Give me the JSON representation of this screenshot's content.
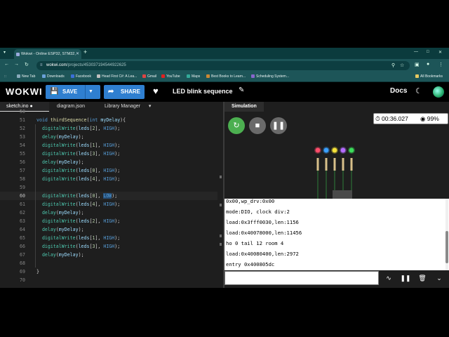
{
  "browser": {
    "tab_title": "Wokwi - Online ESP32, STM32,",
    "url_host": "wokwi.com",
    "url_path": "/projects/453037194544922625",
    "bookmarks": [
      {
        "label": "New Tab",
        "color": "#88aabb"
      },
      {
        "label": "Downloads",
        "color": "#6aa0d8"
      },
      {
        "label": "Facebook",
        "color": "#3b6fd8"
      },
      {
        "label": "Head First C#: A Lea...",
        "color": "#c0c0c0"
      },
      {
        "label": "Gmail",
        "color": "#d44"
      },
      {
        "label": "YouTube",
        "color": "#e02020"
      },
      {
        "label": "Maps",
        "color": "#3a9"
      },
      {
        "label": "Best Books to Learn...",
        "color": "#cc8833"
      },
      {
        "label": "Scheduling System...",
        "color": "#8866cc"
      }
    ],
    "all_bookmarks": "All Bookmarks"
  },
  "toolbar": {
    "logo": "WOKWI",
    "save_label": "SAVE",
    "share_label": "SHARE",
    "project_title": "LED blink sequence",
    "docs_label": "Docs"
  },
  "editor": {
    "tabs": [
      {
        "label": "sketch.ino",
        "modified": "●"
      },
      {
        "label": "diagram.json"
      },
      {
        "label": "Library Manager",
        "dropdown": "▾"
      }
    ],
    "lines": [
      {
        "num": "50",
        "text": ""
      },
      {
        "num": "51",
        "text": "void thirdSequence(int myDelay){"
      },
      {
        "num": "52",
        "text": "  digitalWrite(leds[2], HIGH);"
      },
      {
        "num": "53",
        "text": "  delay(myDelay);"
      },
      {
        "num": "54",
        "text": "  digitalWrite(leds[1], HIGH);"
      },
      {
        "num": "55",
        "text": "  digitalWrite(leds[3], HIGH);"
      },
      {
        "num": "56",
        "text": "  delay(myDelay);"
      },
      {
        "num": "57",
        "text": "  digitalWrite(leds[0], HIGH);"
      },
      {
        "num": "58",
        "text": "  digitalWrite(leds[4], HIGH);"
      },
      {
        "num": "59",
        "text": ""
      },
      {
        "num": "60",
        "text": "  digitalWrite(leds[0], LOW);"
      },
      {
        "num": "61",
        "text": "  digitalWrite(leds[4], HIGH);"
      },
      {
        "num": "62",
        "text": "  delay(myDelay);"
      },
      {
        "num": "63",
        "text": "  digitalWrite(leds[2], HIGH);"
      },
      {
        "num": "64",
        "text": "  delay(myDelay);"
      },
      {
        "num": "65",
        "text": "  digitalWrite(leds[1], HIGH);"
      },
      {
        "num": "66",
        "text": "  digitalWrite(leds[3], HIGH);"
      },
      {
        "num": "67",
        "text": "  delay(myDelay);"
      },
      {
        "num": "68",
        "text": ""
      },
      {
        "num": "69",
        "text": "}"
      },
      {
        "num": "70",
        "text": ""
      }
    ],
    "current_line": "60"
  },
  "simulation": {
    "tab_label": "Simulation",
    "elapsed": "00:36.027",
    "speed": "99%",
    "leds": [
      {
        "color": "#ff4d6a"
      },
      {
        "color": "#3aa0ff"
      },
      {
        "color": "#f5e23a"
      },
      {
        "color": "#b46cff"
      },
      {
        "color": "#3bdc5a"
      }
    ]
  },
  "serial": {
    "lines": [
      "0x00,wp_drv:0x00",
      "mode:DIO, clock div:2",
      "load:0x3fff0030,len:1156",
      "load:0x40078000,len:11456",
      "ho 0 tail 12 room 4",
      "load:0x40080400,len:2972",
      "entry 0x400805dc"
    ],
    "input_placeholder": ""
  },
  "colors": {
    "accent": "#2f7fd0",
    "browser_frame": "#1d5558",
    "editor_bg": "#1e1e1e"
  }
}
